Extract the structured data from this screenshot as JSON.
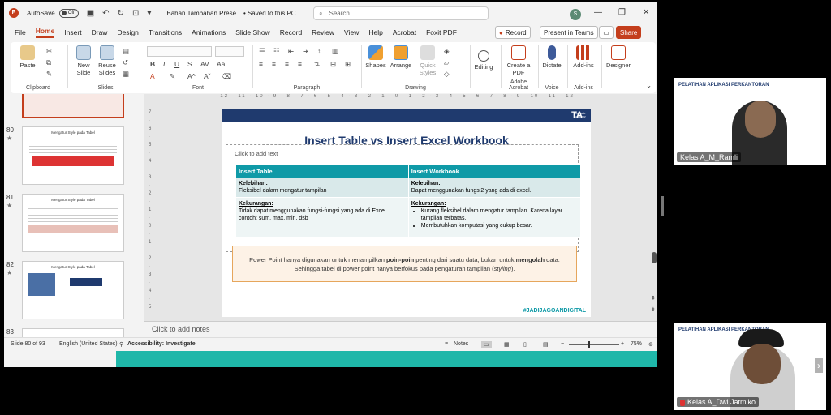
{
  "titlebar": {
    "autosave_label": "AutoSave",
    "autosave_state": "Off",
    "doc_title": "Bahan Tambahan Prese... • Saved to this PC",
    "search_placeholder": "Search",
    "avatar_initial": "S"
  },
  "tabs": [
    "File",
    "Home",
    "Insert",
    "Draw",
    "Design",
    "Transitions",
    "Animations",
    "Slide Show",
    "Record",
    "Review",
    "View",
    "Help",
    "Acrobat",
    "Foxit PDF"
  ],
  "tab_buttons": {
    "record": "Record",
    "present": "Present in Teams",
    "share": "Share"
  },
  "ribbon": {
    "paste": "Paste",
    "clipboard": "Clipboard",
    "new_slide": "New Slide",
    "reuse_slides": "Reuse Slides",
    "slides": "Slides",
    "font": "Font",
    "paragraph": "Paragraph",
    "shapes": "Shapes",
    "arrange": "Arrange",
    "quick_styles": "Quick Styles",
    "drawing": "Drawing",
    "editing": "Editing",
    "create_pdf": "Create a PDF",
    "adobe_acrobat": "Adobe Acrobat",
    "dictate": "Dictate",
    "voice": "Voice",
    "add_ins": "Add-ins",
    "add_ins_group": "Add-ins",
    "designer": "Designer"
  },
  "thumbnails": [
    {
      "num": "80",
      "title": "Mengatur Style pada Tabel"
    },
    {
      "num": "81",
      "title": "Mengatur Style pada Tabel"
    },
    {
      "num": "82",
      "title": "Mengatur Style pada Tabel"
    },
    {
      "num": "83",
      "title": ""
    }
  ],
  "slide": {
    "logo": "TA",
    "logo_sub": "Thematic Academy",
    "title": "Insert Table vs Insert Excel Workbook",
    "placeholder": "Click to add text",
    "col1_header": "Insert Table",
    "col2_header": "Insert Workbook",
    "kelebihan": "Kelebihan:",
    "col1_kelebihan": "Fleksibel dalam mengatur tampilan",
    "col2_kelebihan": "Dapat menggunakan fungsi2 yang ada di excel.",
    "kekurangan": "Kekurangan:",
    "col1_kekurangan": "Tidak dapat menggunakan fungsi-fungsi yang ada di Excel contoh: sum, max, min, dsb",
    "col2_kekurangan_1": "Kurang fleksibel dalam mengatur tampilan. Karena layar tampilan terbatas.",
    "col2_kekurangan_2": "Membutuhkan komputasi yang cukup besar.",
    "note_1a": "Power Point hanya digunakan untuk menampilkan ",
    "note_1b": "poin-poin",
    "note_1c": " penting dari suatu data, bukan untuk ",
    "note_1d": "mengolah",
    "note_1e": " data.",
    "note_2a": "Sehingga tabel di power point hanya berfokus pada pengaturan tampilan (",
    "note_2b": "styling",
    "note_2c": ").",
    "hashtag": "#JADIJAGOANDIGITAL"
  },
  "notes_placeholder": "Click to add notes",
  "status": {
    "slide_count": "Slide 80 of 93",
    "language": "English (United States)",
    "accessibility": "Accessibility: Investigate",
    "notes": "Notes",
    "zoom": "75%"
  },
  "participants": [
    {
      "name": "Kelas A_M_Ramli",
      "brand": "PELATIHAN APLIKASI PERKANTORAN"
    },
    {
      "name": "Kelas A_Dwi Jatmiko",
      "brand": "PELATIHAN APLIKASI PERKANTORAN"
    }
  ]
}
